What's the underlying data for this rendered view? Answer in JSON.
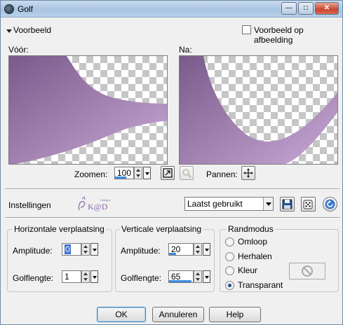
{
  "window": {
    "title": "Golf"
  },
  "preview": {
    "section_label": "Voorbeeld",
    "on_image_label": "Voorbeeld op afbeelding",
    "on_image_checked": false
  },
  "panes": {
    "before_label": "Vóór:",
    "after_label": "Na:"
  },
  "zoom": {
    "label": "Zoomen:",
    "value": "100",
    "pan_label": "Pannen:",
    "fill_fraction": 0.6
  },
  "settings": {
    "label": "Instellingen",
    "preset_value": "Laatst gebruikt"
  },
  "logo": {
    "text": "K@D",
    "brand": "Designs"
  },
  "horizontal": {
    "title": "Horizontale verplaatsing",
    "amplitude_label": "Amplitude:",
    "amplitude_value": "0",
    "amplitude_fill": 0.0,
    "wavelength_label": "Golflengte:",
    "wavelength_value": "1",
    "wavelength_fill": 0.0
  },
  "vertical": {
    "title": "Verticale verplaatsing",
    "amplitude_label": "Amplitude:",
    "amplitude_value": "20",
    "amplitude_fill": 0.3,
    "wavelength_label": "Golflengte:",
    "wavelength_value": "65",
    "wavelength_fill": 0.95
  },
  "edge_mode": {
    "title": "Randmodus",
    "options": [
      "Omloop",
      "Herhalen",
      "Kleur",
      "Transparant"
    ],
    "selected": "Transparant"
  },
  "buttons": {
    "ok": "OK",
    "cancel": "Annuleren",
    "help": "Help"
  },
  "colors": {
    "accent": "#3b8fe0",
    "shape_light": "#c9a9d6",
    "shape_dark": "#7a5a8a"
  }
}
